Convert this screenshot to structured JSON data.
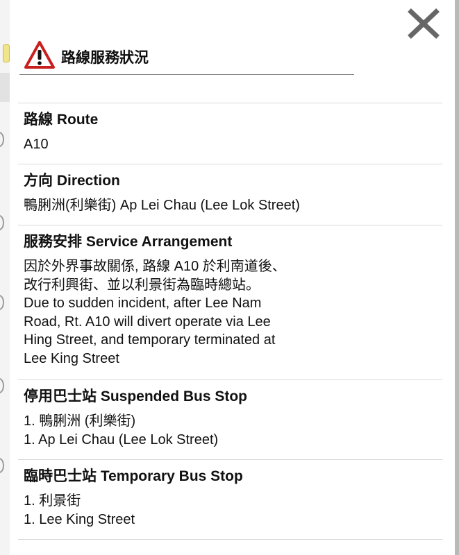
{
  "header": {
    "title": "路線服務狀況"
  },
  "route": {
    "title": "路線 Route",
    "value": "A10"
  },
  "direction": {
    "title": "方向 Direction",
    "value": "鴨脷洲(利樂街) Ap Lei Chau (Lee Lok Street)"
  },
  "arrangement": {
    "title": "服務安排 Service Arrangement",
    "lines": [
      "因於外界事故關係, 路線 A10 於利南道後、",
      "改行利興街、並以利景街為臨時總站。",
      "Due to sudden incident, after Lee Nam",
      "Road, Rt. A10 will divert operate via Lee",
      "Hing Street, and temporary terminated at",
      "Lee King Street"
    ]
  },
  "suspended": {
    "title": "停用巴士站 Suspended Bus Stop",
    "lines": [
      "1. 鴨脷洲 (利樂街)",
      "1. Ap Lei Chau (Lee Lok Street)"
    ]
  },
  "temporary": {
    "title": "臨時巴士站 Temporary Bus Stop",
    "lines": [
      "1. 利景街",
      "1. Lee King Street"
    ]
  },
  "icons": {
    "close": "close-icon",
    "warning": "warning-triangle-icon"
  },
  "colors": {
    "warning_red": "#c8201e",
    "text": "#111111",
    "close_gray": "#666666"
  }
}
